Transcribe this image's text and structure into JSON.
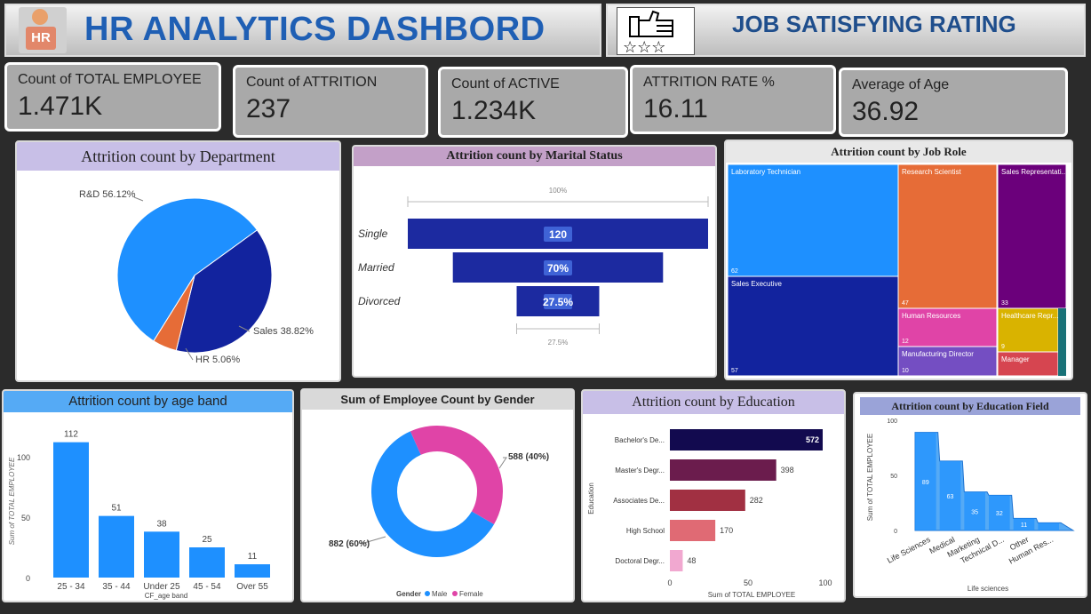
{
  "header": {
    "logo_text": "HR",
    "title": "HR ANALYTICS DASHBORD",
    "subtitle": "JOB SATISFYING RATING"
  },
  "kpis": [
    {
      "label": "Count of TOTAL EMPLOYEE",
      "value": "1.471K"
    },
    {
      "label": "Count of ATTRITION",
      "value": "237"
    },
    {
      "label": "Count of ACTIVE",
      "value": "1.234K"
    },
    {
      "label": "ATTRITION RATE %",
      "value": "16.11"
    },
    {
      "label": "Average of Age",
      "value": "36.92"
    }
  ],
  "colors": {
    "blue": "#1e90ff",
    "navy": "#12239e",
    "orange": "#e66c37",
    "purple": "#6b007b",
    "pink": "#e044a7",
    "header_lavender": "#c8bfe7"
  },
  "chart_data": [
    {
      "type": "pie",
      "title": "Attrition count by Department",
      "slices": [
        {
          "label": "R&D 56.12%",
          "name": "R&D",
          "value": 56.12
        },
        {
          "label": "Sales 38.82%",
          "name": "Sales",
          "value": 38.82
        },
        {
          "label": "HR 5.06%",
          "name": "HR",
          "value": 5.06
        }
      ]
    },
    {
      "type": "bar",
      "title": "Attrition count by Marital Status",
      "top_label": "100%",
      "bottom_label": "27.5%",
      "categories": [
        "Single",
        "Married",
        "Divorced"
      ],
      "values": [
        120,
        84,
        33
      ],
      "data_labels": [
        "120",
        "70%",
        "27.5%"
      ]
    },
    {
      "type": "table",
      "title": "Attrition count by Job Role",
      "items": [
        {
          "name": "Laboratory Technician",
          "value": 62
        },
        {
          "name": "Sales Executive",
          "value": 57
        },
        {
          "name": "Research Scientist",
          "value": 47
        },
        {
          "name": "Sales Representati...",
          "value": 33
        },
        {
          "name": "Human Resources",
          "value": 12
        },
        {
          "name": "Manufacturing Director",
          "value": 10
        },
        {
          "name": "Healthcare Repr...",
          "value": 9
        },
        {
          "name": "Manager",
          "value": ""
        }
      ]
    },
    {
      "type": "bar",
      "title": "Attrition count by age band",
      "xlabel": "CF_age band",
      "ylabel": "Sum of TOTAL EMPLOYEE",
      "categories": [
        "25 - 34",
        "35 - 44",
        "Under 25",
        "45 - 54",
        "Over 55"
      ],
      "values": [
        112,
        51,
        38,
        25,
        11
      ],
      "yticks": [
        0,
        50,
        100
      ],
      "ylim": [
        0,
        125
      ]
    },
    {
      "type": "pie",
      "title": "Sum of Employee Count by Gender",
      "legend_title": "Gender",
      "slices": [
        {
          "name": "Male",
          "value": 882,
          "label": "882 (60%)"
        },
        {
          "name": "Female",
          "value": 588,
          "label": "588 (40%)"
        }
      ]
    },
    {
      "type": "bar",
      "title": "Attrition count by Education",
      "xlabel": "Sum of TOTAL EMPLOYEE",
      "ylabel": "Education",
      "categories": [
        "Bachelor's De...",
        "Master's Degr...",
        "Associates De...",
        "High School",
        "Doctoral Degr..."
      ],
      "values": [
        572,
        398,
        282,
        170,
        48
      ],
      "xticks": [
        "0",
        "50",
        "100"
      ]
    },
    {
      "type": "area",
      "title": "Attrition count by Education Field",
      "xlabel": "Life sciences",
      "ylabel": "Sum of TOTAL EMPLOYEE",
      "categories": [
        "Life Sciences",
        "Medical",
        "Marketing",
        "Technical D...",
        "Other",
        "Human Res..."
      ],
      "values": [
        89,
        63,
        35,
        32,
        11,
        7
      ],
      "data_labels": [
        "89",
        "63",
        "35",
        "32",
        "11",
        ""
      ],
      "yticks": [
        0,
        50,
        100
      ],
      "ylim": [
        0,
        100
      ]
    }
  ]
}
